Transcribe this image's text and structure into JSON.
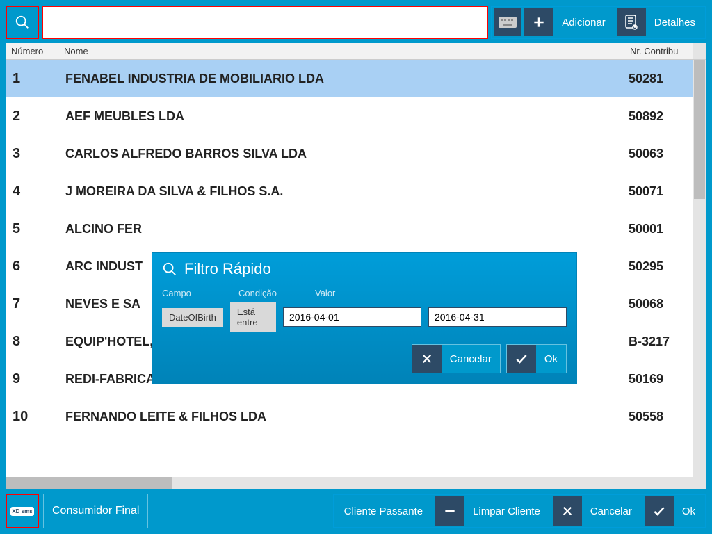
{
  "topbar": {
    "search_value": "",
    "adicionar_label": "Adicionar",
    "detalhes_label": "Detalhes"
  },
  "columns": {
    "numero": "Número",
    "nome": "Nome",
    "nif": "Nr. Contribu"
  },
  "rows": [
    {
      "num": "1",
      "nome": "FENABEL INDUSTRIA DE MOBILIARIO LDA",
      "nif": "50281",
      "selected": true
    },
    {
      "num": "2",
      "nome": "AEF MEUBLES LDA",
      "nif": "50892",
      "selected": false
    },
    {
      "num": "3",
      "nome": "CARLOS ALFREDO BARROS SILVA LDA",
      "nif": "50063",
      "selected": false
    },
    {
      "num": "4",
      "nome": "J MOREIRA DA SILVA & FILHOS S.A.",
      "nif": "50071",
      "selected": false
    },
    {
      "num": "5",
      "nome": "ALCINO FER",
      "nif": "50001",
      "selected": false
    },
    {
      "num": "6",
      "nome": "ARC INDUST",
      "nif": "50295",
      "selected": false
    },
    {
      "num": "7",
      "nome": "NEVES E SA",
      "nif": "50068",
      "selected": false
    },
    {
      "num": "8",
      "nome": "EQUIP'HOTEL, SL",
      "nif": "B-3217",
      "selected": false
    },
    {
      "num": "9",
      "nome": "REDI-FABRICA DE MOVEIS METALICOS S.A.",
      "nif": "50169",
      "selected": false
    },
    {
      "num": "10",
      "nome": "FERNANDO LEITE & FILHOS LDA",
      "nif": "50558",
      "selected": false
    }
  ],
  "dialog": {
    "title": "Filtro Rápido",
    "label_campo": "Campo",
    "label_condicao": "Condição",
    "label_valor": "Valor",
    "campo": "DateOfBirth",
    "condicao": "Está entre",
    "valor1": "2016-04-01",
    "valor2": "2016-04-31",
    "cancelar": "Cancelar",
    "ok": "Ok"
  },
  "bottombar": {
    "consumidor": "Consumidor Final",
    "cliente_passante": "Cliente Passante",
    "limpar": "Limpar Cliente",
    "cancelar": "Cancelar",
    "ok": "Ok",
    "logo": "XD sms"
  }
}
